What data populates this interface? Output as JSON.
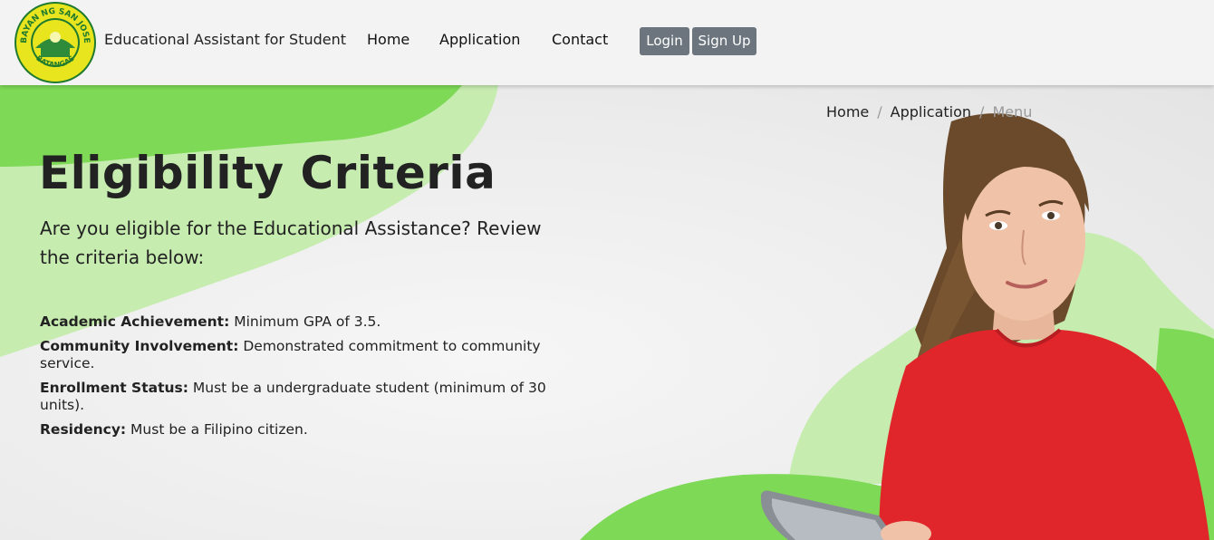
{
  "navbar": {
    "logo": {
      "icon": "municipal-seal-icon",
      "top_text": "BAYAN NG SAN JOSE",
      "bottom_text": "BATANGAS"
    },
    "brand": "Educational Assistant for Student",
    "links": [
      "Home",
      "Application",
      "Contact"
    ],
    "login_label": "Login",
    "signup_label": "Sign Up"
  },
  "breadcrumb": {
    "items": [
      "Home",
      "Application"
    ],
    "separator": "/",
    "active": "Menu"
  },
  "hero": {
    "title": "Eligibility Criteria",
    "subtitle": "Are you eligible for the Educational Assistance? Review the criteria below:",
    "criteria": [
      {
        "label": "Academic Achievement:",
        "text": " Minimum GPA of 3.5."
      },
      {
        "label": "Community Involvement:",
        "text": " Demonstrated commitment to community service."
      },
      {
        "label": "Enrollment Status:",
        "text": " Must be a undergraduate student (minimum of 30 units)."
      },
      {
        "label": "Residency:",
        "text": " Must be a Filipino citizen."
      }
    ],
    "image": "student-with-tablet-photo"
  },
  "colors": {
    "accent_green": "#7ed957",
    "light_green": "#c6ecb0",
    "button_gray": "#6c757d",
    "shirt_red": "#e0262b"
  }
}
